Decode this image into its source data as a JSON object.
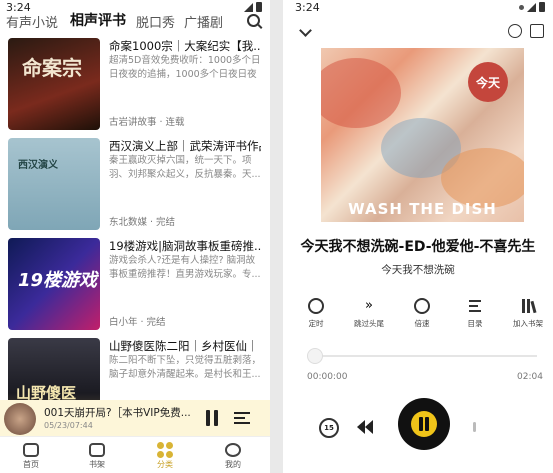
{
  "left": {
    "status": {
      "time": "3:24"
    },
    "tabs": [
      "有声小说",
      "相声评书",
      "脱口秀",
      "广播剧"
    ],
    "books": [
      {
        "title": "命案1000宗｜大案纪实【我...",
        "desc": "超清5D音效免费收听：1000多个日日夜夜的追捕，1000多个日夜日夜",
        "meta": "古岩讲故事 · 连载",
        "cover_text": "命案宗"
      },
      {
        "title": "西汉演义上部｜武荣涛评书作品",
        "desc": "秦王赢政灭掉六国，统一天下。项羽、刘邦聚众起义，反抗暴秦。天...",
        "meta": "东北数媒 · 完结",
        "cover_text": "西汉演义"
      },
      {
        "title": "19楼游戏|脑洞故事板重磅推...",
        "desc": "游戏会杀人?还是有人操控? 脑洞故事板重磅推荐！直男游戏玩家。专...",
        "meta": "白小年 · 完结",
        "cover_text": "19楼游戏"
      },
      {
        "title": "山野傻医陈二阳｜乡村医仙｜【...",
        "desc": "陈二阳不断下坠，只觉得五脏剥落，脑子却意外清醒起来。是村长和王...",
        "meta": "",
        "cover_text": "山野傻医"
      }
    ],
    "mini_player": {
      "title": "001天崩开局?［本书VIP免费...",
      "time": "05/23/07:44"
    },
    "nav": [
      "首页",
      "书架",
      "分类",
      "我的"
    ]
  },
  "right": {
    "status": {
      "time": "3:24"
    },
    "art_text": "WASH THE DISH",
    "art_badge": "今天",
    "song_title": "今天我不想洗碗-ED-他爱他-不喜先生",
    "artist": "今天我不想洗碗",
    "controls": [
      "定时",
      "跳过头尾",
      "倍速",
      "目录",
      "加入书架"
    ],
    "time_current": "00:00:00",
    "time_total": "02:04",
    "rewind_label": "15"
  },
  "colors": {
    "accent": "#f0c419",
    "mini_bg": "#fdf6d9"
  }
}
